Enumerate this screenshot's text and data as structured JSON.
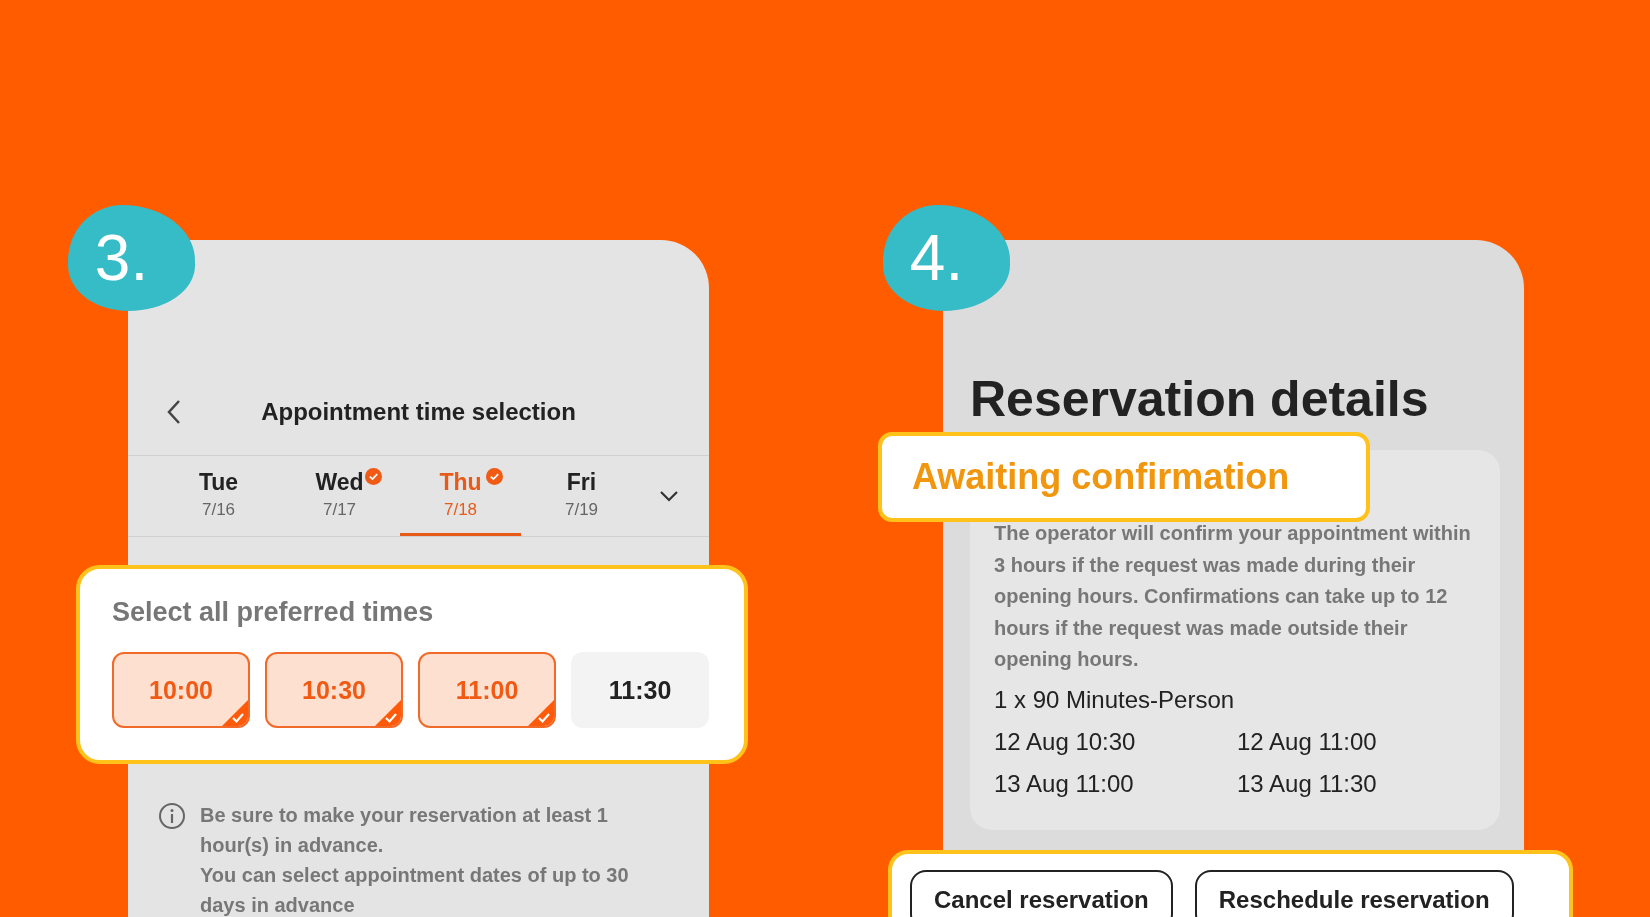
{
  "steps": [
    {
      "number": "3.",
      "kind": "time_selection",
      "title": "Appointment time selection",
      "days": [
        {
          "day": "Tue",
          "date": "7/16",
          "selected": false,
          "checked": false
        },
        {
          "day": "Wed",
          "date": "7/17",
          "selected": false,
          "checked": true
        },
        {
          "day": "Thu",
          "date": "7/18",
          "selected": true,
          "checked": true
        },
        {
          "day": "Fri",
          "date": "7/19",
          "selected": false,
          "checked": false
        }
      ],
      "times_heading": "Select all preferred times",
      "times": [
        {
          "time": "10:00",
          "selected": true
        },
        {
          "time": "10:30",
          "selected": true
        },
        {
          "time": "11:00",
          "selected": true
        },
        {
          "time": "11:30",
          "selected": false
        }
      ],
      "notes": [
        "Be sure to make your reservation at least 1 hour(s) in advance.",
        "You can select appointment dates of up to 30 days in advance"
      ]
    },
    {
      "number": "4.",
      "kind": "details",
      "title": "Reservation details",
      "status": "Awaiting confirmation",
      "message": "The operator will confirm your appointment within 3 hours if the request was made during their opening hours. Confirmations can take up to 12 hours if the request was made outside their opening hours.",
      "service": "1 x 90 Minutes-Person",
      "slots": [
        "12 Aug 10:30",
        "12 Aug 11:00",
        "13 Aug 11:00",
        "13 Aug 11:30"
      ],
      "buttons": [
        "Cancel reservation",
        "Reschedule reservation"
      ]
    }
  ]
}
